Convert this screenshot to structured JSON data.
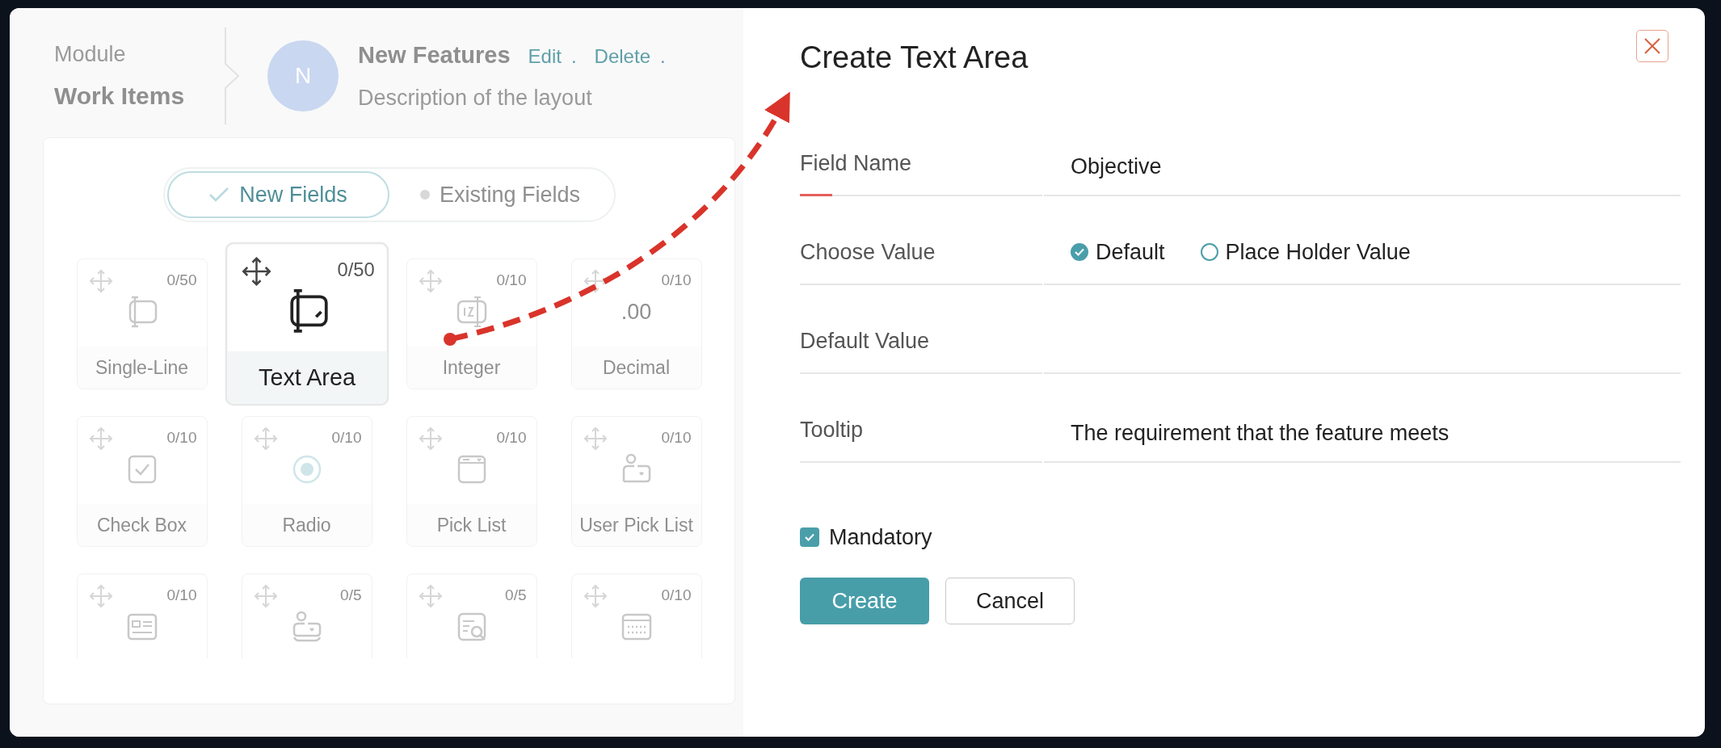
{
  "breadcrumb": {
    "label": "Module",
    "value": "Work Items"
  },
  "layout": {
    "avatar": "N",
    "name": "New Features",
    "description": "Description of the layout",
    "actions": [
      {
        "kind": "link",
        "text": "Edit"
      },
      {
        "kind": "separator",
        "text": "."
      },
      {
        "kind": "link",
        "text": "Delete"
      },
      {
        "kind": "separator",
        "text": "."
      }
    ]
  },
  "field_tabs": [
    {
      "label": "New Fields",
      "selected": true
    },
    {
      "label": "Existing Fields",
      "selected": false
    }
  ],
  "field_types": [
    {
      "kind": "single-line",
      "count": "0/50",
      "label": "Single-Line",
      "selected": false
    },
    {
      "kind": "text-area",
      "count": "0/50",
      "label": "Text Area",
      "selected": true
    },
    {
      "kind": "integer",
      "count": "0/10",
      "label": "Integer",
      "selected": false
    },
    {
      "kind": "decimal",
      "count": "0/10",
      "label": "Decimal",
      "icon_text": ".00",
      "selected": false
    },
    {
      "kind": "check-box",
      "count": "0/10",
      "label": "Check Box",
      "selected": false
    },
    {
      "kind": "radio",
      "count": "0/10",
      "label": "Radio",
      "selected": false
    },
    {
      "kind": "pick-list",
      "count": "0/10",
      "label": "Pick List",
      "selected": false
    },
    {
      "kind": "user-pick-list",
      "count": "0/10",
      "label": "User Pick List",
      "selected": false
    },
    {
      "kind": "id-card",
      "count": "0/10",
      "selected": false
    },
    {
      "kind": "user-card",
      "count": "0/5",
      "selected": false
    },
    {
      "kind": "search-list",
      "count": "0/5",
      "selected": false
    },
    {
      "kind": "calendar",
      "count": "0/10",
      "selected": false
    }
  ],
  "dialog": {
    "title": "Create Text Area",
    "fields": [
      {
        "kind": "text",
        "label": "Field Name",
        "value": "Objective",
        "focused": true
      },
      {
        "kind": "radio",
        "label": "Choose Value",
        "focused": false,
        "options": [
          {
            "label": "Default",
            "selected": true
          },
          {
            "label": "Place Holder Value",
            "selected": false
          }
        ]
      },
      {
        "kind": "text",
        "label": "Default Value",
        "focused": false
      },
      {
        "kind": "text",
        "label": "Tooltip",
        "value": "The requirement that the feature meets",
        "focused": false
      }
    ],
    "mandatory": {
      "label": "Mandatory",
      "checked": true
    },
    "buttons": [
      {
        "kind": "primary",
        "label": "Create"
      },
      {
        "kind": "secondary",
        "label": "Cancel"
      }
    ]
  }
}
